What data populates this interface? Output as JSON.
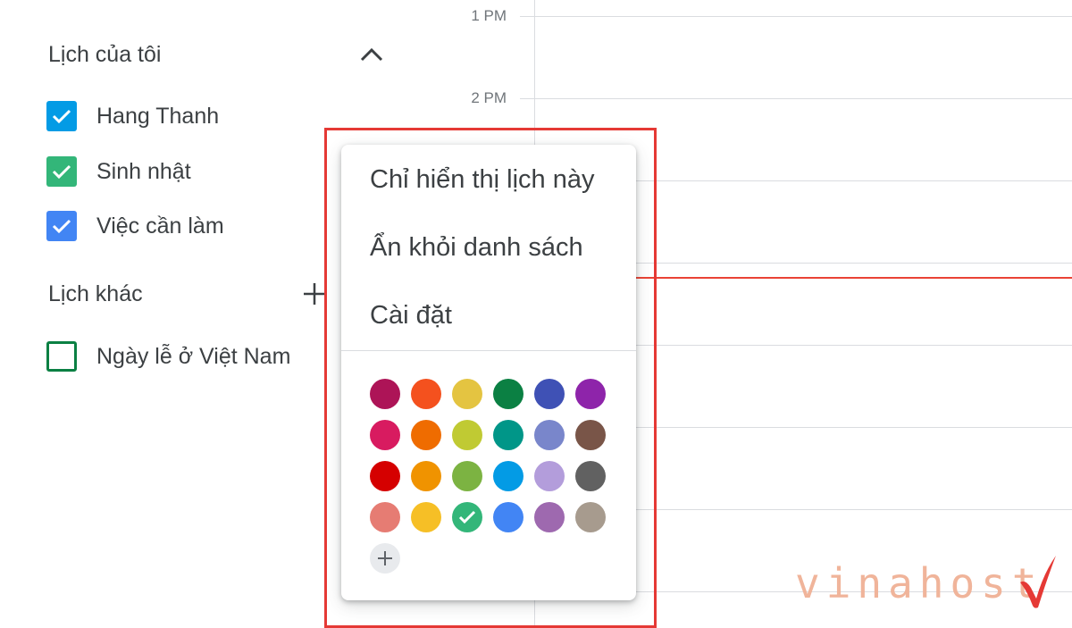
{
  "sidebar": {
    "my_calendars_title": "Lịch của tôi",
    "my_calendars": [
      {
        "label": "Hang Thanh",
        "color": "#039be5",
        "checked": true
      },
      {
        "label": "Sinh nhật",
        "color": "#33b679",
        "checked": true
      },
      {
        "label": "Việc cần làm",
        "color": "#4285f4",
        "checked": true
      }
    ],
    "other_calendars_title": "Lịch khác",
    "other_calendars": [
      {
        "label": "Ngày lễ ở Việt Nam",
        "color": "#0b8043",
        "checked": false
      }
    ]
  },
  "grid": {
    "time_labels": [
      "1 PM",
      "2 PM"
    ],
    "now_indicator_color": "#ea4335"
  },
  "menu": {
    "items": [
      "Chỉ hiển thị lịch này",
      "Ẩn khỏi danh sách",
      "Cài đặt"
    ],
    "selected_color": "#33b679",
    "colors": [
      [
        "#ad1457",
        "#f4511e",
        "#e4c441",
        "#0b8043",
        "#3f51b5",
        "#8e24aa"
      ],
      [
        "#d81b60",
        "#ef6c00",
        "#c0ca33",
        "#009688",
        "#7986cb",
        "#795548"
      ],
      [
        "#d50000",
        "#f09300",
        "#7cb342",
        "#039be5",
        "#b39ddb",
        "#616161"
      ],
      [
        "#e67c73",
        "#f6bf26",
        "#33b679",
        "#4285f4",
        "#9e69af",
        "#a79b8e"
      ]
    ]
  },
  "watermark": {
    "text": "vinahost"
  },
  "highlight_color": "#e53935"
}
